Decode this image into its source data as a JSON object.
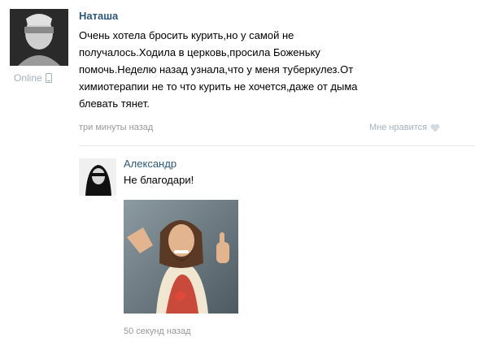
{
  "post": {
    "author": "Наташа",
    "text": "Очень хотела бросить курить,но у самой не\nполучалось.Ходила в церковь,просила Боженьку\nпомочь.Неделю назад узнала,что у меня туберкулез.От\nхимиотерапии не то что курить не хочется,даже от дыма\nблевать тянет.",
    "status": "Online",
    "time": "три минуты назад",
    "like_label": "Мне нравится"
  },
  "reply": {
    "author": "Александр",
    "text": "Не благодари!",
    "time": "50 секунд назад"
  },
  "colors": {
    "link": "#2b587a",
    "muted": "#999999",
    "status": "#a5b1c0",
    "divider": "#e4e8ed"
  },
  "icons": {
    "status": "mobile-phone-icon",
    "like": "heart-icon"
  }
}
